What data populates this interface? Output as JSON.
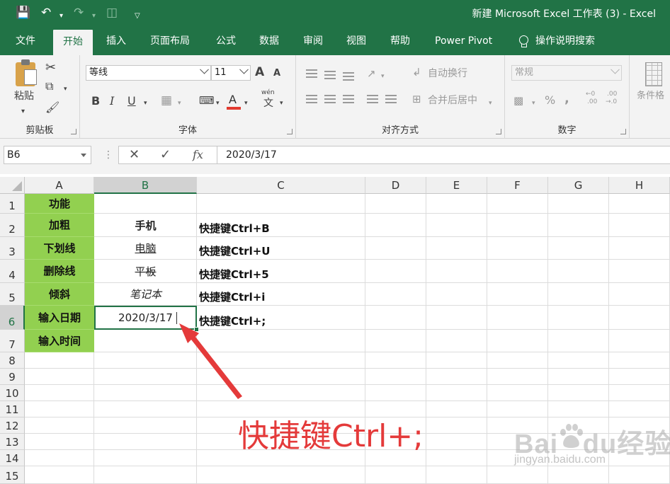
{
  "quick_access": {
    "save_icon": "save-icon",
    "undo_icon": "undo-icon",
    "redo_icon": "redo-icon",
    "print_preview_icon": "print-preview-icon",
    "customize_icon": "chevron-down-icon"
  },
  "title": "新建 Microsoft Excel 工作表 (3)  -  Excel",
  "tabs": [
    "文件",
    "开始",
    "插入",
    "页面布局",
    "公式",
    "数据",
    "审阅",
    "视图",
    "帮助",
    "Power Pivot"
  ],
  "active_tab": "开始",
  "tell_me": "操作说明搜索",
  "ribbon": {
    "clipboard": {
      "paste": "粘贴",
      "label": "剪贴板"
    },
    "font": {
      "font_name": "等线",
      "font_size": "11",
      "grow": "A",
      "shrink": "A",
      "bold": "B",
      "italic": "I",
      "underline": "U",
      "font_color": "A",
      "phonetic_top": "wén",
      "phonetic_bottom": "文",
      "label": "字体"
    },
    "alignment": {
      "wrap_text": "自动换行",
      "merge_center": "合并后居中",
      "label": "对齐方式"
    },
    "number": {
      "format": "常规",
      "percent": "%",
      "comma": ",",
      "inc_decimal_top": "←0",
      "inc_decimal_bottom": ".00",
      "dec_decimal_top": ".00",
      "dec_decimal_bottom": "→.0",
      "label": "数字"
    },
    "styles": {
      "conditional_format": "条件格"
    }
  },
  "formula_bar": {
    "name_box": "B6",
    "cancel": "✕",
    "enter": "✓",
    "fx": "fx",
    "content": "2020/3/17"
  },
  "columns": [
    "A",
    "B",
    "C",
    "D",
    "E",
    "F",
    "G",
    "H"
  ],
  "rows": [
    "1",
    "2",
    "3",
    "4",
    "5",
    "6",
    "7",
    "8",
    "9",
    "10",
    "11",
    "12",
    "13",
    "14",
    "15"
  ],
  "cells": {
    "A": [
      "功能",
      "加粗",
      "下划线",
      "删除线",
      "倾斜",
      "输入日期",
      "输入时间"
    ],
    "B": [
      "",
      "手机",
      "电脑",
      "平板",
      "笔记本",
      "2020/3/17",
      ""
    ],
    "C": [
      "",
      "快捷键Ctrl+B",
      "快捷键Ctrl+U",
      "快捷键Ctrl+5",
      "快捷键Ctrl+i",
      "快捷键Ctrl+;",
      ""
    ]
  },
  "active_cell": "B6",
  "annotation": {
    "text": "快捷键Ctrl+;",
    "color": "#e43a3a"
  },
  "watermark": {
    "logo": "Baidu经验",
    "url": "jingyan.baidu.com"
  },
  "colors": {
    "excel_green": "#217346",
    "header_fill": "#92d050",
    "annotation_red": "#e43a3a"
  }
}
